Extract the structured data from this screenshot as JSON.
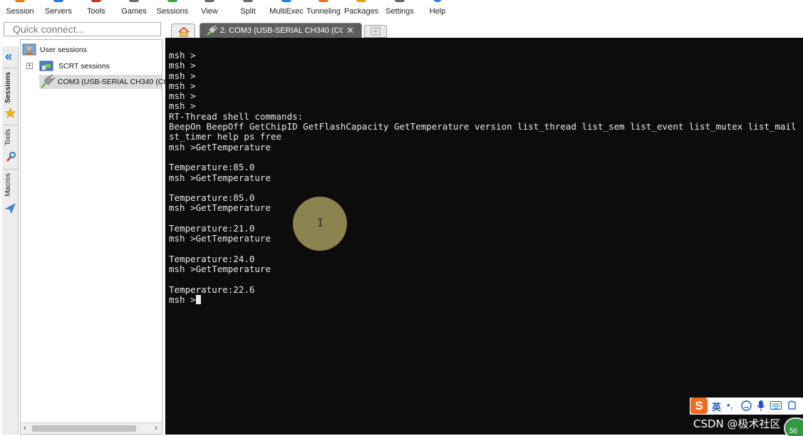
{
  "toolbar": {
    "items": [
      {
        "label": "Session",
        "icon": "session-icon",
        "color": "#e07a1e"
      },
      {
        "label": "Servers",
        "icon": "servers-icon",
        "color": "#2a7ad6"
      },
      {
        "label": "Tools",
        "icon": "tools-icon",
        "color": "#c0392b"
      },
      {
        "label": "Games",
        "icon": "games-icon",
        "color": "#6b6b6b"
      },
      {
        "label": "Sessions",
        "icon": "sessions-icon",
        "color": "#3fa34d"
      },
      {
        "label": "View",
        "icon": "view-icon",
        "color": "#6b6b6b"
      },
      {
        "label": "Split",
        "icon": "split-icon",
        "color": "#6b6b6b"
      },
      {
        "label": "MultiExec",
        "icon": "multiexec-icon",
        "color": "#2a7ad6"
      },
      {
        "label": "Tunneling",
        "icon": "tunneling-icon",
        "color": "#e07a1e"
      },
      {
        "label": "Packages",
        "icon": "packages-icon",
        "color": "#e0a01e"
      },
      {
        "label": "Settings",
        "icon": "settings-icon",
        "color": "#6b6b6b"
      },
      {
        "label": "Help",
        "icon": "help-icon",
        "color": "#2a7ad6"
      }
    ]
  },
  "quick_connect": {
    "placeholder": "Quick connect..."
  },
  "tabs": {
    "home_icon": "home-icon",
    "active_label": "2. COM3  (USB-SERIAL CH340 (CO",
    "close_glyph": "✕",
    "new_tab_icon": "new-tab-icon"
  },
  "side_tabs": {
    "sessions": "Sessions",
    "tools": "Tools",
    "macros": "Macros"
  },
  "session_tree": {
    "root": "User sessions",
    "items": [
      {
        "label": "SCRT sessions",
        "icon": "folder-icon"
      },
      {
        "label": "COM3  (USB-SERIAL CH340 (CC",
        "icon": "serial-plug-icon"
      }
    ]
  },
  "terminal": {
    "lines": [
      "msh >",
      "msh >",
      "msh >",
      "msh >",
      "msh >",
      "msh >",
      "RT-Thread shell commands:",
      "BeepOn BeepOff GetChipID GetFlashCapacity GetTemperature version list_thread list_sem list_event list_mutex list_mail",
      "st_timer help ps free",
      "msh >GetTemperature",
      "",
      "Temperature:85.0",
      "msh >GetTemperature",
      "",
      "Temperature:85.0",
      "msh >GetTemperature",
      "",
      "Temperature:21.0",
      "msh >GetTemperature",
      "",
      "Temperature:24.0",
      "msh >GetTemperature",
      "",
      "Temperature:22.6"
    ],
    "prompt": "msh >"
  },
  "ime": {
    "logo": "S",
    "lang": "英",
    "dot": "•,"
  },
  "watermark": "CSDN @极术社区",
  "badge": "56"
}
